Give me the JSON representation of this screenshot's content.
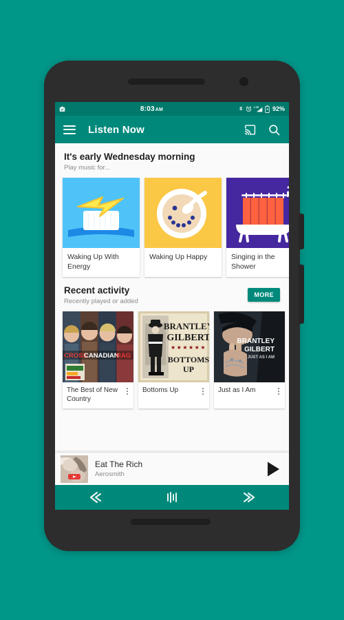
{
  "app": {
    "title": "Listen Now",
    "accent": "#00897B",
    "background": "#009688"
  },
  "status_bar": {
    "time": "8:03",
    "ampm": "AM",
    "battery": "92%",
    "icons_left": [
      "screenshot-icon"
    ],
    "icons_right": [
      "bluetooth-icon",
      "alarm-icon",
      "lte-signal-icon",
      "battery-charging-icon"
    ]
  },
  "toolbar": {
    "menu_icon": "hamburger-menu-icon",
    "title": "Listen Now",
    "cast_icon": "cast-icon",
    "search_icon": "search-icon"
  },
  "hero": {
    "title": "It's early Wednesday morning",
    "subtitle": "Play music for...",
    "cards": [
      {
        "label": "Waking Up With Energy",
        "art": "toothbrush-lightning",
        "bg": "#4FC3F7"
      },
      {
        "label": "Waking Up Happy",
        "art": "cereal-bowl-smiley",
        "bg": "#FBC846"
      },
      {
        "label": "Singing in the Shower",
        "art": "bathtub-shower-curtain",
        "bg": "#4527A0"
      }
    ]
  },
  "recent": {
    "title": "Recent activity",
    "subtitle": "Recently played or added",
    "more_label": "MORE",
    "items": [
      {
        "title": "The Best of New Country",
        "art": "cross-canadian-ragweed-band-photo",
        "art_text": "CROSS CANADIAN RAGWEED"
      },
      {
        "title": "Bottoms Up",
        "art": "brantley-gilbert-bottoms-up-poster",
        "art_text": "BRANTLEY GILBERT BOTTOMS UP"
      },
      {
        "title": "Just as I Am",
        "art": "brantley-gilbert-just-as-i-am",
        "art_text": "BRANTLEY GILBERT JUST AS I AM"
      }
    ]
  },
  "now_playing": {
    "track": "Eat The Rich",
    "artist": "Aerosmith",
    "source_badge": "youtube-icon",
    "play_icon": "play-icon"
  },
  "nav_bar": {
    "back_icon": "back-chevron-icon",
    "home_icon": "home-bars-icon",
    "recents_icon": "recents-double-chevron-icon"
  }
}
